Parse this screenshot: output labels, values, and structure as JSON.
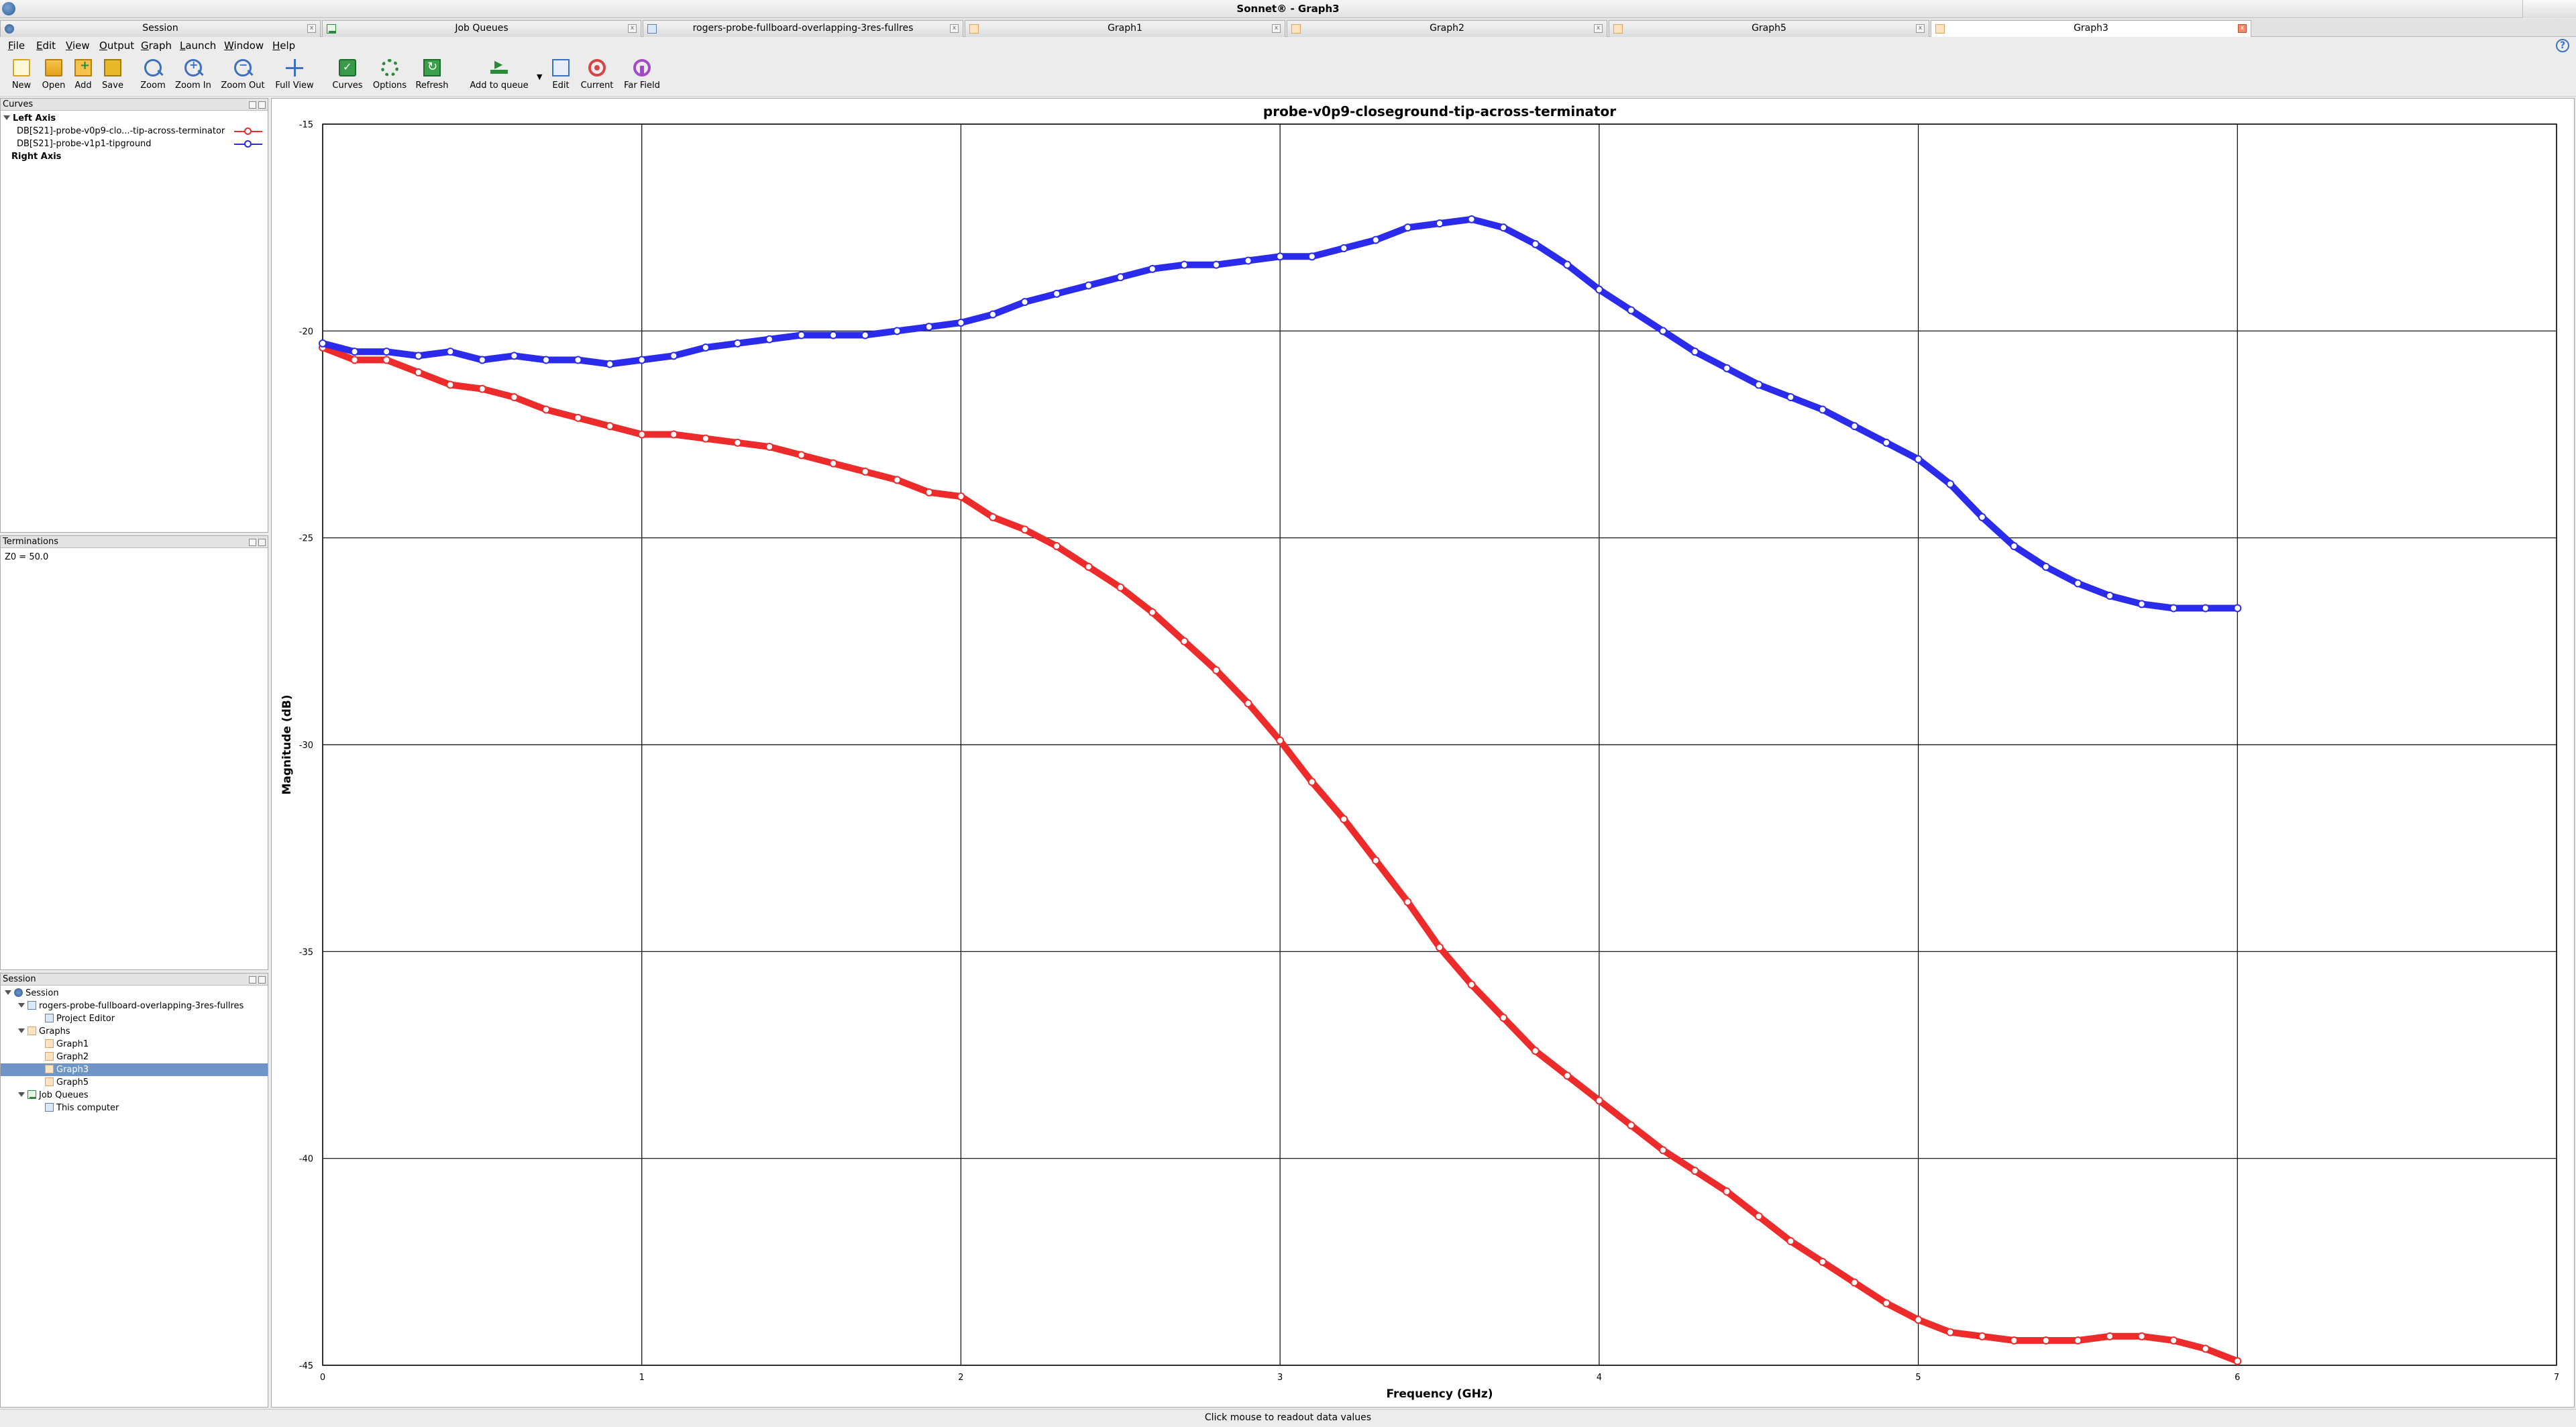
{
  "window": {
    "title": "Sonnet® - Graph3"
  },
  "tabs": [
    {
      "label": "Session",
      "icon": "session-icon",
      "active": false
    },
    {
      "label": "Job Queues",
      "icon": "queue-icon",
      "active": false
    },
    {
      "label": "rogers-probe-fullboard-overlapping-3res-fullres",
      "icon": "project-icon",
      "active": false
    },
    {
      "label": "Graph1",
      "icon": "graph-icon",
      "active": false
    },
    {
      "label": "Graph2",
      "icon": "graph-icon",
      "active": false
    },
    {
      "label": "Graph5",
      "icon": "graph-icon",
      "active": false
    },
    {
      "label": "Graph3",
      "icon": "graph-icon",
      "active": true
    }
  ],
  "menu": [
    "File",
    "Edit",
    "View",
    "Output",
    "Graph",
    "Launch",
    "Window",
    "Help"
  ],
  "toolbar": {
    "new": "New",
    "open": "Open",
    "add": "Add",
    "save": "Save",
    "zoom": "Zoom",
    "zoom_in": "Zoom In",
    "zoom_out": "Zoom Out",
    "full_view": "Full View",
    "curves": "Curves",
    "options": "Options",
    "refresh": "Refresh",
    "add_to_queue": "Add to queue",
    "edit": "Edit",
    "current": "Current",
    "far_field": "Far Field"
  },
  "curves_panel": {
    "title": "Curves",
    "left_axis": "Left Axis",
    "right_axis": "Right Axis",
    "items": [
      {
        "label": "DB[S21]-probe-v0p9-clo...-tip-across-terminator",
        "color": "#ee2b2b"
      },
      {
        "label": "DB[S21]-probe-v1p1-tipground",
        "color": "#2b2bee"
      }
    ]
  },
  "terminations_panel": {
    "title": "Terminations",
    "z0": "Z0 = 50.0"
  },
  "session_panel": {
    "title": "Session",
    "root": "Session",
    "project": "rogers-probe-fullboard-overlapping-3res-fullres",
    "project_editor": "Project Editor",
    "graphs": "Graphs",
    "graph_items": [
      "Graph1",
      "Graph2",
      "Graph3",
      "Graph5"
    ],
    "selected_graph": "Graph3",
    "job_queues": "Job Queues",
    "this_computer": "This computer"
  },
  "status_text": "Click mouse to readout data values",
  "chart_data": {
    "type": "line",
    "title": "probe-v0p9-closeground-tip-across-terminator",
    "xlabel": "Frequency (GHz)",
    "ylabel": "Magnitude (dB)",
    "xlim": [
      0,
      7
    ],
    "ylim": [
      -45,
      -15
    ],
    "xticks": [
      0,
      1,
      2,
      3,
      4,
      5,
      6,
      7
    ],
    "yticks": [
      -15,
      -20,
      -25,
      -30,
      -35,
      -40,
      -45
    ],
    "grid": true,
    "series": [
      {
        "name": "DB[S21]-probe-v0p9-clo...-tip-across-terminator",
        "color": "#ee2b2b",
        "x": [
          0,
          0.1,
          0.2,
          0.3,
          0.4,
          0.5,
          0.6,
          0.7,
          0.8,
          0.9,
          1.0,
          1.1,
          1.2,
          1.3,
          1.4,
          1.5,
          1.6,
          1.7,
          1.8,
          1.9,
          2.0,
          2.1,
          2.2,
          2.3,
          2.4,
          2.5,
          2.6,
          2.7,
          2.8,
          2.9,
          3.0,
          3.1,
          3.2,
          3.3,
          3.4,
          3.5,
          3.6,
          3.7,
          3.8,
          3.9,
          4.0,
          4.1,
          4.2,
          4.3,
          4.4,
          4.5,
          4.6,
          4.7,
          4.8,
          4.9,
          5.0,
          5.1,
          5.2,
          5.3,
          5.4,
          5.5,
          5.6,
          5.7,
          5.8,
          5.9,
          6.0
        ],
        "y": [
          -20.4,
          -20.7,
          -20.7,
          -21.0,
          -21.3,
          -21.4,
          -21.6,
          -21.9,
          -22.1,
          -22.3,
          -22.5,
          -22.5,
          -22.6,
          -22.7,
          -22.8,
          -23.0,
          -23.2,
          -23.4,
          -23.6,
          -23.9,
          -24.0,
          -24.5,
          -24.8,
          -25.2,
          -25.7,
          -26.2,
          -26.8,
          -27.5,
          -28.2,
          -29.0,
          -29.9,
          -30.9,
          -31.8,
          -32.8,
          -33.8,
          -34.9,
          -35.8,
          -36.6,
          -37.4,
          -38.0,
          -38.6,
          -39.2,
          -39.8,
          -40.3,
          -40.8,
          -41.4,
          -42.0,
          -42.5,
          -43.0,
          -43.5,
          -43.9,
          -44.2,
          -44.3,
          -44.4,
          -44.4,
          -44.4,
          -44.3,
          -44.3,
          -44.4,
          -44.6,
          -44.9
        ]
      },
      {
        "name": "DB[S21]-probe-v1p1-tipground",
        "color": "#2b2bee",
        "x": [
          0,
          0.1,
          0.2,
          0.3,
          0.4,
          0.5,
          0.6,
          0.7,
          0.8,
          0.9,
          1.0,
          1.1,
          1.2,
          1.3,
          1.4,
          1.5,
          1.6,
          1.7,
          1.8,
          1.9,
          2.0,
          2.1,
          2.2,
          2.3,
          2.4,
          2.5,
          2.6,
          2.7,
          2.8,
          2.9,
          3.0,
          3.1,
          3.2,
          3.3,
          3.4,
          3.5,
          3.6,
          3.7,
          3.8,
          3.9,
          4.0,
          4.1,
          4.2,
          4.3,
          4.4,
          4.5,
          4.6,
          4.7,
          4.8,
          4.9,
          5.0,
          5.1,
          5.2,
          5.3,
          5.4,
          5.5,
          5.6,
          5.7,
          5.8,
          5.9,
          6.0
        ],
        "y": [
          -20.3,
          -20.5,
          -20.5,
          -20.6,
          -20.5,
          -20.7,
          -20.6,
          -20.7,
          -20.7,
          -20.8,
          -20.7,
          -20.6,
          -20.4,
          -20.3,
          -20.2,
          -20.1,
          -20.1,
          -20.1,
          -20.0,
          -19.9,
          -19.8,
          -19.6,
          -19.3,
          -19.1,
          -18.9,
          -18.7,
          -18.5,
          -18.4,
          -18.4,
          -18.3,
          -18.2,
          -18.2,
          -18.0,
          -17.8,
          -17.5,
          -17.4,
          -17.3,
          -17.5,
          -17.9,
          -18.4,
          -19.0,
          -19.5,
          -20.0,
          -20.5,
          -20.9,
          -21.3,
          -21.6,
          -21.9,
          -22.3,
          -22.7,
          -23.1,
          -23.7,
          -24.5,
          -25.2,
          -25.7,
          -26.1,
          -26.4,
          -26.6,
          -26.7,
          -26.7,
          -26.7
        ]
      }
    ]
  }
}
